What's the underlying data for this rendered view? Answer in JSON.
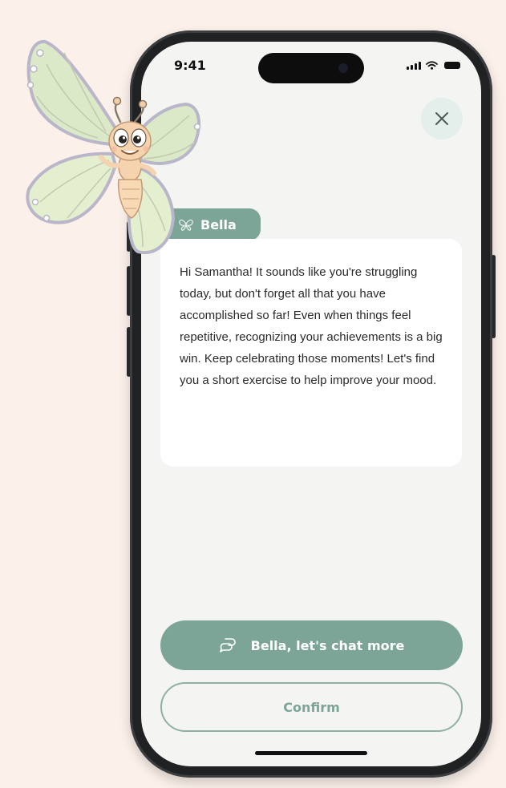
{
  "status_bar": {
    "time": "9:41",
    "icons": [
      "cellular-signal-icon",
      "wifi-icon",
      "battery-icon"
    ]
  },
  "close_icon": "close-icon",
  "message": {
    "sender_icon": "butterfly-icon",
    "sender_name": "Bella",
    "text": "Hi Samantha! It sounds like you're struggling today, but don't forget all that you have accomplished so far!  Even when things feel repetitive, recognizing your achievements is a big win. Keep celebrating those moments! Let's find you a short exercise to help improve your mood."
  },
  "actions": {
    "chat_icon": "chat-bubbles-icon",
    "chat_label": "Bella, let's chat more",
    "confirm_label": "Confirm"
  },
  "colors": {
    "background": "#fbf0ea",
    "screen": "#f4f4f3",
    "accent": "#7da597",
    "close_bg": "#e4eeea"
  },
  "mascot_icon": "butterfly-mascot"
}
